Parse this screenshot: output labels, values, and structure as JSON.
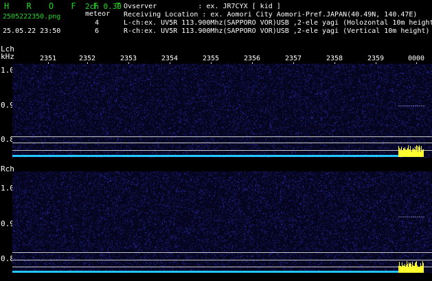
{
  "header": {
    "app_title": "H R O F F T",
    "mode": "2ch 0.30",
    "filename": "2505222350.png",
    "meteor_label": "meteor",
    "count_l": "4",
    "count_r": "6",
    "datetime": "25.05.22 23:50",
    "observer": "Ovserver          : ex. JR7CYX [ kid ]",
    "location": "Receiving Location : ex. Aomori City Aomori-Pref.JAPAN(40.49N, 140.47E)",
    "lch_info": "L-ch:ex. UV5R 113.900Mhz(SAPPORO VOR)USB ,2-ele yagi (Holozontal 10m height)",
    "rch_info": "R-ch:ex. UV5R 113.900Mhz(SAPPORO VOR)USB ,2-ele yagi (Vertical 10m height)"
  },
  "axis": {
    "lch_label": "Lch",
    "khz_label": "kHz",
    "rch_label": "Rch",
    "time_ticks": [
      "2351",
      "2352",
      "2353",
      "2354",
      "2355",
      "2356",
      "2357",
      "2358",
      "2359",
      "0000"
    ],
    "lch_freq": [
      "1.0",
      "0.9",
      "0.8"
    ],
    "rch_freq": [
      "1.0",
      "0.9",
      "0.8"
    ]
  },
  "colors": {
    "background": "#000000",
    "noise": "#1a1a7a",
    "title_green": "#1fd81f",
    "cyan": "#22c8ff",
    "yellow": "#ffff30"
  }
}
